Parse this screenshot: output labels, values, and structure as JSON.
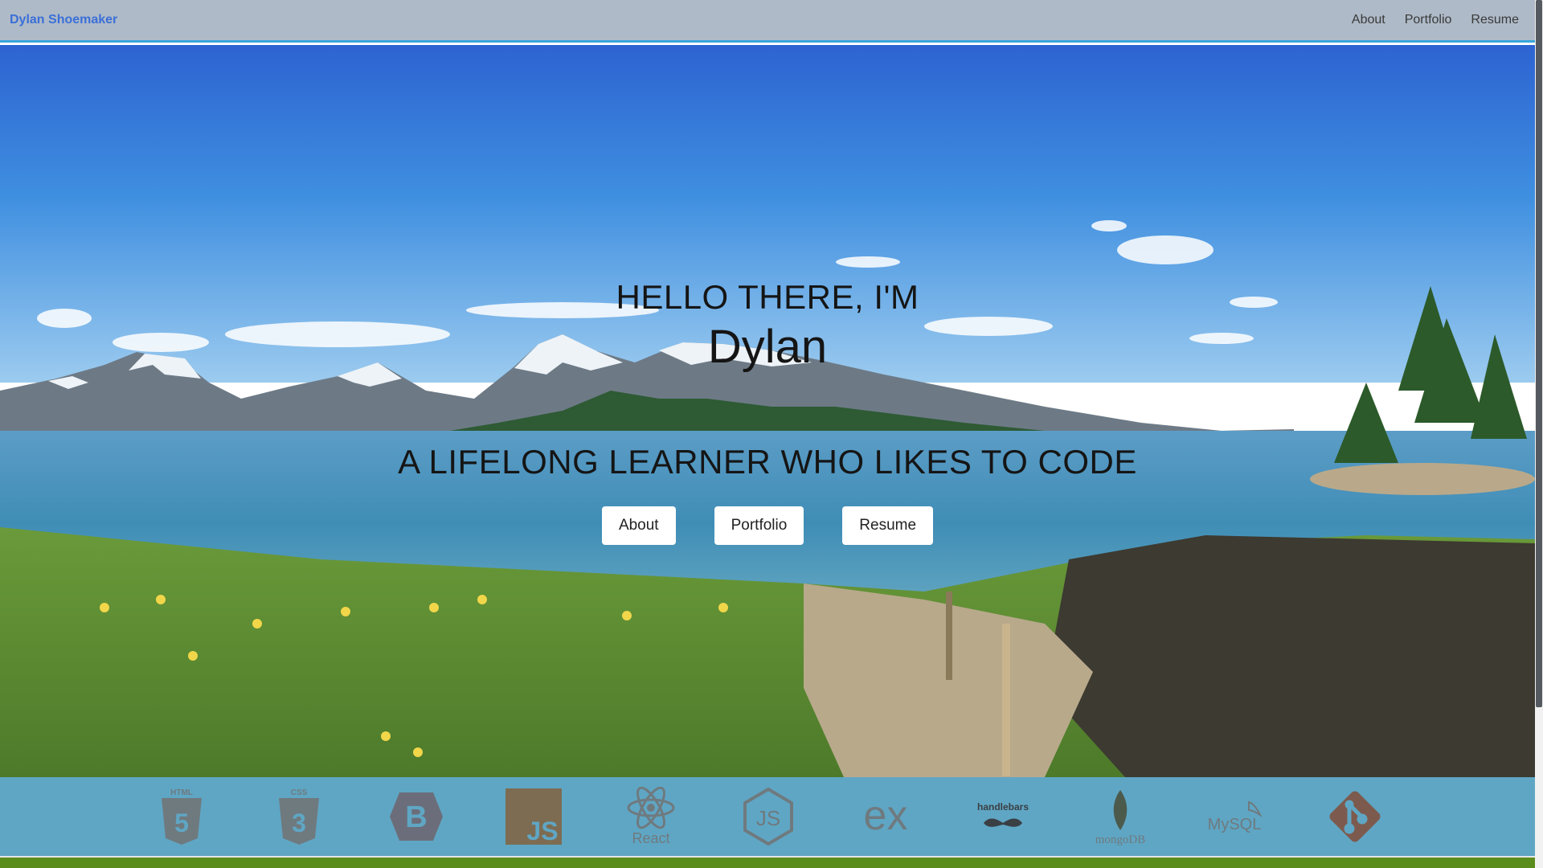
{
  "navbar": {
    "brand": "Dylan Shoemaker",
    "links": [
      "About",
      "Portfolio",
      "Resume"
    ]
  },
  "hero": {
    "greeting": "HELLO THERE, I'M",
    "name": "Dylan",
    "tagline": "A LIFELONG LEARNER WHO LIKES TO CODE",
    "buttons": [
      "About",
      "Portfolio",
      "Resume"
    ]
  },
  "tech_strip": {
    "icons": [
      {
        "name": "html5-icon",
        "label": "HTML"
      },
      {
        "name": "css3-icon",
        "label": "CSS"
      },
      {
        "name": "bootstrap-icon",
        "label": "B"
      },
      {
        "name": "javascript-icon",
        "label": "JS"
      },
      {
        "name": "react-icon",
        "label": "React"
      },
      {
        "name": "nodejs-icon",
        "label": "JS"
      },
      {
        "name": "express-icon",
        "label": "ex"
      },
      {
        "name": "handlebars-icon",
        "label": "handlebars"
      },
      {
        "name": "mongodb-icon",
        "label": "mongoDB"
      },
      {
        "name": "mysql-icon",
        "label": "MySQL"
      },
      {
        "name": "git-icon",
        "label": ""
      }
    ]
  },
  "colors": {
    "navbar_bg": "#aebac7",
    "brand": "#3b6fd8",
    "accent_border": "#3aa6dc",
    "tech_strip_bg": "#5fa6c4",
    "icon_tint": "#6f7a7f",
    "footer_bar": "#5a8d1b"
  }
}
